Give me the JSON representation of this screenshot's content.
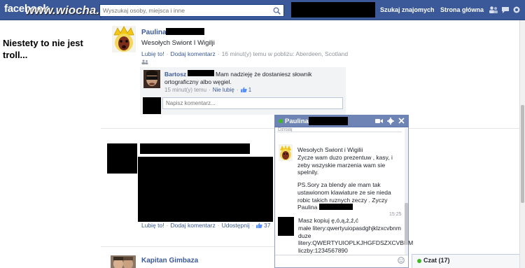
{
  "topbar": {
    "logo": "facebook",
    "watermark": "www.wiocha.pl",
    "search_placeholder": "Wyszukaj osoby, miejsca i inne",
    "nav_find": "Szukaj znajomych",
    "nav_home": "Strona główna"
  },
  "caption": "Niestety to nie jest troll...",
  "post1": {
    "author": "Paulina",
    "text": "Wesołych Swiont I Wigilji",
    "like": "Lubię to!",
    "comment": "Dodaj komentarz",
    "time_place": "16 minut(y) temu w pobliżu: Aberdeen, Scotland"
  },
  "comment1": {
    "author": "Bartosz",
    "text": "Mam nadzieję że dostaniesz słownik ortograficzny albo węgiel.",
    "time": "15 minut(y) temu",
    "unlike": "Nie lubię",
    "likes": "1"
  },
  "comment_input": {
    "placeholder": "Napisz komentarz..."
  },
  "post2": {
    "like": "Lubię to!",
    "comment": "Dodaj komentarz",
    "share": "Udostępnij",
    "likes": "37"
  },
  "post3": {
    "author": "Kapitan Gimbaza"
  },
  "chat": {
    "name": "Paulina",
    "prev_label": "Dzisiaj",
    "msg1": "Wesołych Swiont i Wigilii\nZycze wam duzo prezentuw , kasy, i zeby wszyskie marzenia wam sie spelnily.",
    "msg1_ps": "PS.Sory za blendy ale mam tak ustawionom klawiature ze sie nieda robic takich ruznych zeczy . Zyczy Paulina",
    "time": "15:25",
    "msg2": "Masz kopiuj ę,ó,ą,ż,ź,ć\nmałe litery:qwertyuiopasdghjklzxcvbnm\nduze litery:QWERTYUIOPLKJHGFDSZXCVBNM\nliczby:1234567890"
  },
  "chatbar": {
    "label": "Czat (17)"
  },
  "colors": {
    "brand": "#3b5998",
    "online": "#42b72a"
  }
}
